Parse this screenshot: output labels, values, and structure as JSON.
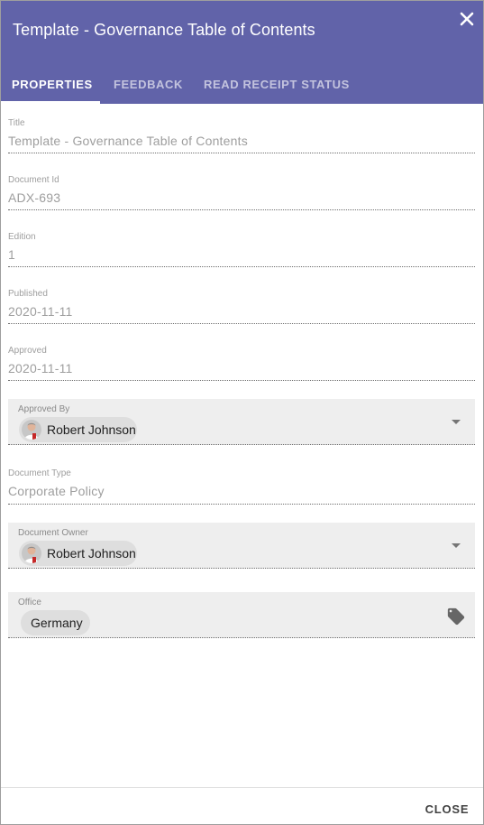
{
  "dialog": {
    "title": "Template - Governance Table of Contents",
    "close_icon": "close-icon"
  },
  "tabs": [
    {
      "label": "PROPERTIES",
      "active": true
    },
    {
      "label": "FEEDBACK",
      "active": false
    },
    {
      "label": "READ RECEIPT STATUS",
      "active": false
    }
  ],
  "fields": {
    "title": {
      "label": "Title",
      "value": "Template - Governance Table of Contents"
    },
    "document_id": {
      "label": "Document Id",
      "value": "ADX-693"
    },
    "edition": {
      "label": "Edition",
      "value": "1"
    },
    "published": {
      "label": "Published",
      "value": "2020-11-11"
    },
    "approved": {
      "label": "Approved",
      "value": "2020-11-11"
    },
    "approved_by": {
      "label": "Approved By",
      "chip": "Robert Johnson"
    },
    "document_type": {
      "label": "Document Type",
      "value": "Corporate Policy"
    },
    "document_owner": {
      "label": "Document Owner",
      "chip": "Robert Johnson"
    },
    "office": {
      "label": "Office",
      "chip": "Germany",
      "icon": "tag-icon"
    }
  },
  "footer": {
    "close_label": "CLOSE"
  },
  "colors": {
    "header": "#6163a9",
    "text_muted": "#9e9e9e",
    "field_bg": "#eeeeee",
    "chip_bg": "#dedede"
  }
}
